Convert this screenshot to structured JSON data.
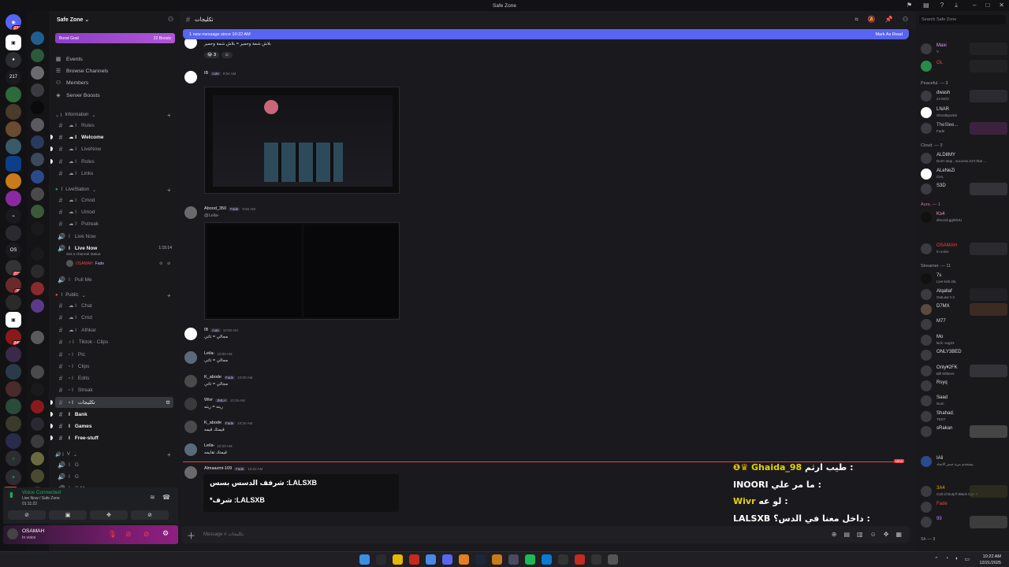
{
  "window": {
    "title": "Safe Zone"
  },
  "server": {
    "name": "Safe Zone",
    "boost_goal": "Boost Goal",
    "boost_count": "22 Boosts",
    "nav": [
      "Events",
      "Browse Channels",
      "Members",
      "Server Boosts"
    ],
    "rail_badges": {
      "top": "234",
      "mid1": "219",
      "mid2": "30",
      "mid3": "348",
      "new": "NEW"
    }
  },
  "categories": {
    "information": "Information",
    "livestation": "LiveStation",
    "public": "Public",
    "v": "V"
  },
  "channels_info": [
    "Rules",
    "Welcome",
    "LiveNow",
    "Roles",
    "Links"
  ],
  "channels_live": [
    "Cmod",
    "Umod",
    "Pstreak",
    "Live Now"
  ],
  "voice_live": {
    "name": "Live Now",
    "timer": "1:15:14",
    "status": "Set a channel status",
    "member": "OSAMAH",
    "member_tag": "Fade",
    "pull": "Pull Me"
  },
  "channels_public": [
    "Chat",
    "Cmd",
    "Athkar",
    "Tiktok - Clips",
    "Pic",
    "Clips",
    "Edits",
    "Streak",
    "تكليجات",
    "Bank",
    "Games",
    "Free-stuff"
  ],
  "channels_v": [
    "G",
    "G",
    "G M"
  ],
  "voice_panel": {
    "status": "Voice Connected",
    "where": "Live Now / Safe Zone",
    "time": "01:11:22"
  },
  "user": {
    "name": "OSAMAH",
    "status": "In voice"
  },
  "chat": {
    "channel": "تكليجات",
    "banner_left": "1 new message since 10:22 AM",
    "banner_right": "Mark As Read",
    "composer_placeholder": "Message #  تكليجات"
  },
  "messages": [
    {
      "user": "",
      "text": "بلاش شمة وحمير = بلاش شمة وحمير",
      "reaction_count": "3"
    },
    {
      "user": "IB",
      "tag": "cute",
      "time": "9:54 AM"
    },
    {
      "user": "Abood_350",
      "tag": "Fade",
      "time": "9:56 AM",
      "reply": "@Leila-"
    },
    {
      "user": "IB",
      "tag": "cute",
      "time": "10:00 AM",
      "text": "مجالي = تاتي"
    },
    {
      "user": "Leila-",
      "time": "10:00 AM",
      "text": "مجالي = تاتي"
    },
    {
      "user": "K_abode",
      "tag": "Fade",
      "time": "10:00 AM",
      "text": "مجالي = تاتي"
    },
    {
      "user": "Wivr",
      "tag": "JMLH",
      "time": "10:19 AM",
      "text": "ريته = ريته"
    },
    {
      "user": "K_abode",
      "tag": "Fade",
      "time": "10:20 AM",
      "text": "قيمتك قيمه"
    },
    {
      "user": "Leila-",
      "time": "10:20 AM",
      "text": "قيمتك تقايمه"
    },
    {
      "user": "Almaazmi-109",
      "tag": "Fade",
      "time": "10:22 AM"
    }
  ],
  "new_tag": "NEW",
  "embed_lines": [
    "شرفف الدسس بسس :LALSXB",
    "*شرف :LALSXB"
  ],
  "overlay": [
    {
      "name": "Ghaida_98",
      "text": "طيب ارثم :"
    },
    {
      "name": "INOORI",
      "text": "ما مر علي :"
    },
    {
      "name": "Wivr",
      "text": "لو عه :"
    },
    {
      "name": "LALSXB",
      "text": "داخل معنا في الدس؟ :"
    }
  ],
  "members": {
    "search": "Search Safe Zone",
    "groups": [
      "Peaceful. — 3",
      "Cloud. — 3",
      "Aura. — 1",
      "Streamer. — 11",
      "Sh — 3"
    ],
    "list": [
      {
        "name": "Maxi",
        "status": "V"
      },
      {
        "name": "OL",
        "status": ""
      },
      {
        "name": "dwash",
        "status": "24 NOV"
      },
      {
        "name": "LNAR",
        "status": "Ghost5portal"
      },
      {
        "name": "TheSlee...",
        "status": "Fade"
      },
      {
        "name": "ALD8MY",
        "status": "Don't stop , success isn't that ..."
      },
      {
        "name": "ALeNeZi",
        "status": "CHL"
      },
      {
        "name": "S3D",
        "status": ""
      },
      {
        "name": "Ks4",
        "status": "discord.gg/MUU"
      },
      {
        "name": "OSAMAH",
        "status": "In voice"
      },
      {
        "name": "7s",
        "status": "Live kick.sfa"
      },
      {
        "name": "Alqallaf",
        "status": "OutLaw V.2"
      },
      {
        "name": "D7MX",
        "status": ""
      },
      {
        "name": "M77",
        "status": ""
      },
      {
        "name": "Mo",
        "status": "kick: vug23"
      },
      {
        "name": "ONLY3BED",
        "status": ""
      },
      {
        "name": "Only¥2FK",
        "status": "Bill Withers"
      },
      {
        "name": "Rsyq",
        "status": ""
      },
      {
        "name": "Saad",
        "status": "Nom"
      },
      {
        "name": "Shahad.",
        "status": "TEST"
      },
      {
        "name": "sRakan",
        "status": ""
      },
      {
        "name": "IAli",
        "status": "يستخدم مزج جيمز الاتحاد"
      },
      {
        "name": "3A4",
        "status": "Call of Duty® Black Ops 7"
      },
      {
        "name": "Fade",
        "status": ""
      },
      {
        "name": "99",
        "status": ""
      }
    ]
  },
  "taskbar": {
    "time": "10:22 AM",
    "date": "12/21/2025"
  }
}
